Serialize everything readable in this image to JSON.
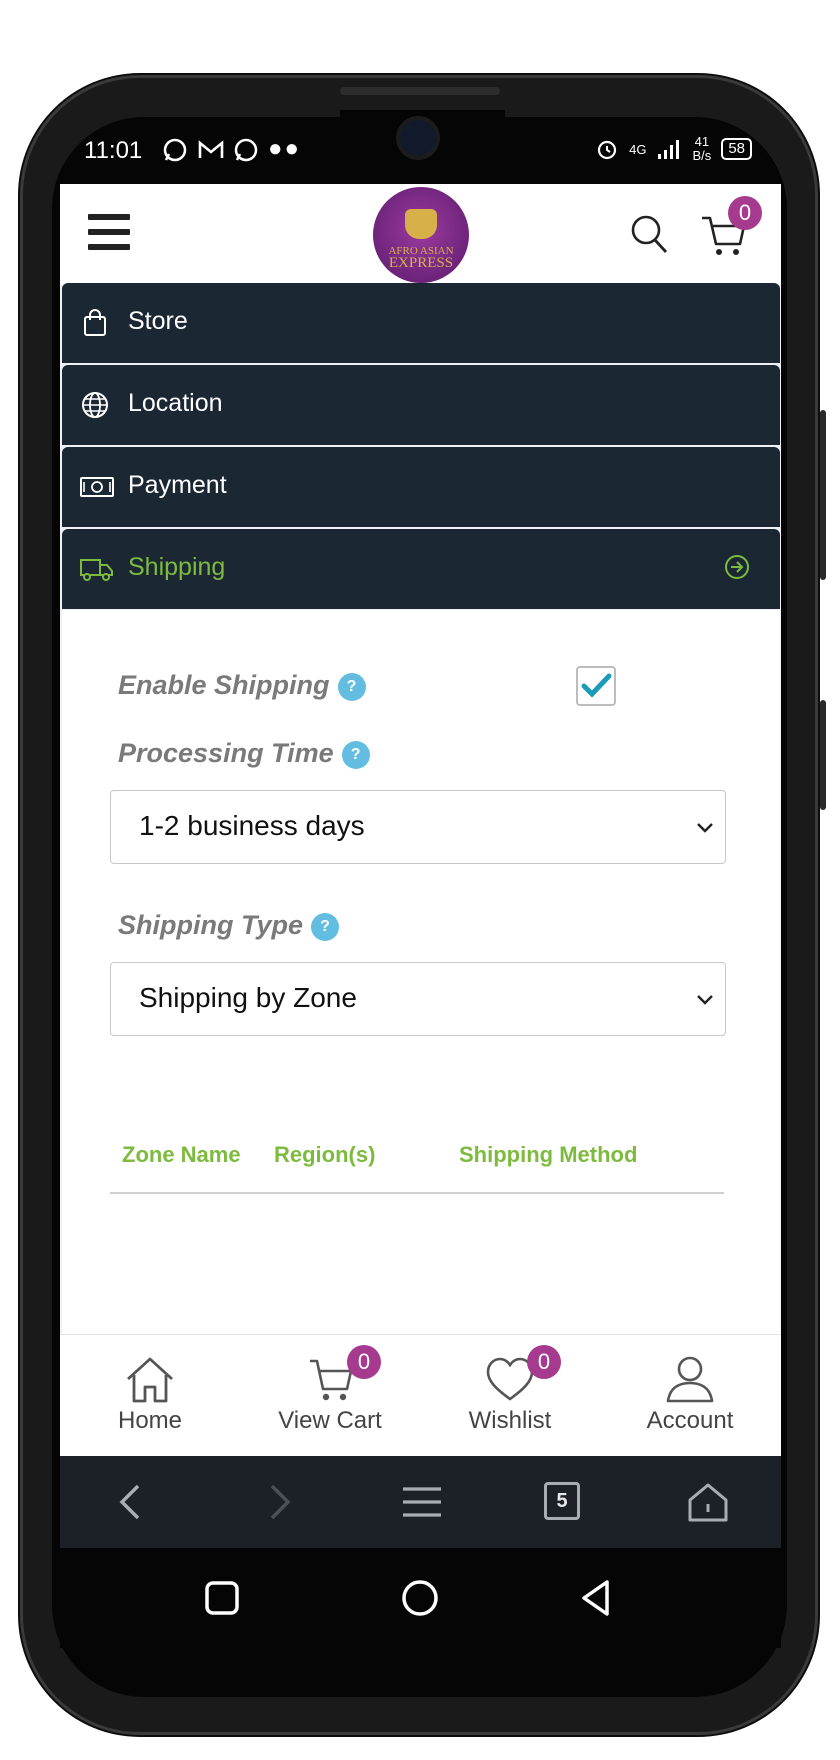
{
  "status_bar": {
    "time": "11:01",
    "left_icons": "●●",
    "network": "4G",
    "speed_top": "41",
    "speed_bottom": "B/s",
    "battery": "58"
  },
  "header": {
    "logo_alt": "AFRO ASIAN EXPRESS",
    "logo_line1": "AFRO ASIAN",
    "logo_line2": "EXPRESS",
    "cart_count": "0"
  },
  "accordion": [
    {
      "label": "Store",
      "icon": "shopping-bag-icon",
      "active": false
    },
    {
      "label": "Location",
      "icon": "globe-icon",
      "active": false
    },
    {
      "label": "Payment",
      "icon": "cash-icon",
      "active": false
    },
    {
      "label": "Shipping",
      "icon": "truck-icon",
      "active": true
    }
  ],
  "shipping": {
    "enable_label": "Enable Shipping",
    "enable_checked": true,
    "processing_label": "Processing Time",
    "processing_value": "1-2 business days",
    "type_label": "Shipping Type",
    "type_value": "Shipping by Zone",
    "help_glyph": "?",
    "table_headers": [
      "Zone Name",
      "Region(s)",
      "Shipping Method"
    ]
  },
  "bottom_nav": [
    {
      "label": "Home",
      "icon": "home-icon"
    },
    {
      "label": "View Cart",
      "icon": "cart-icon",
      "badge": "0"
    },
    {
      "label": "Wishlist",
      "icon": "heart-icon",
      "badge": "0"
    },
    {
      "label": "Account",
      "icon": "user-icon"
    }
  ],
  "browser_bar": {
    "tabs_count": "5"
  },
  "colors": {
    "accordion_bg": "#1b2833",
    "accent_green": "#7dbb3e",
    "badge_purple": "#a63a8f",
    "help_blue": "#63bde0",
    "check_teal": "#1b9bb8"
  }
}
